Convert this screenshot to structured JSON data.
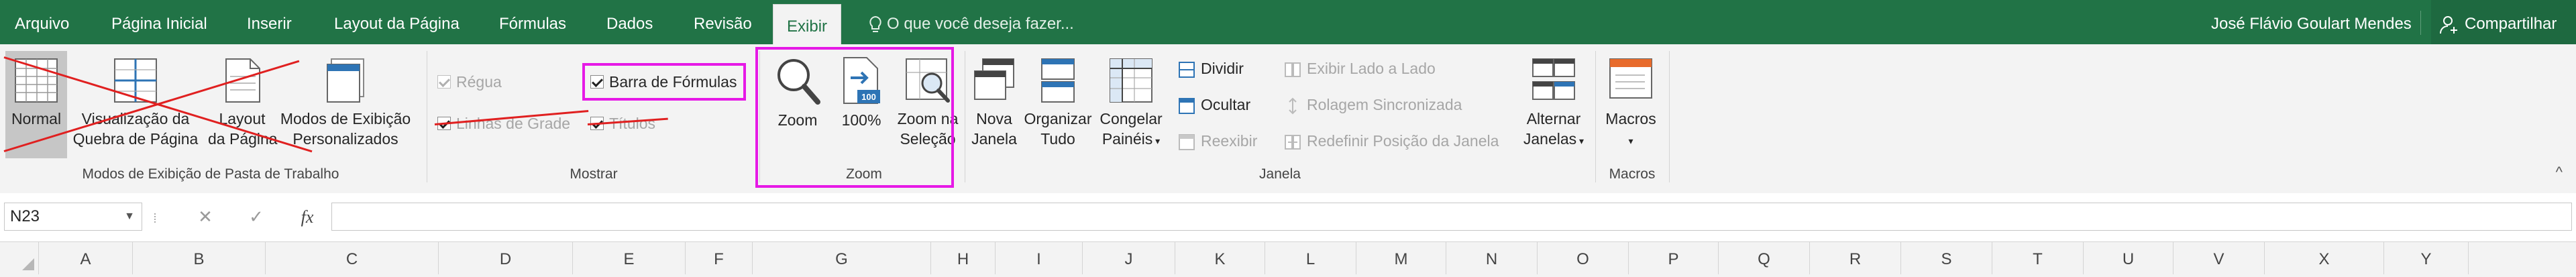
{
  "tabs": [
    {
      "label": "Arquivo"
    },
    {
      "label": "Página Inicial"
    },
    {
      "label": "Inserir"
    },
    {
      "label": "Layout da Página"
    },
    {
      "label": "Fórmulas"
    },
    {
      "label": "Dados"
    },
    {
      "label": "Revisão"
    },
    {
      "label": "Exibir",
      "active": true
    }
  ],
  "tell_me": "O que você deseja fazer...",
  "user_name": "José Flávio Goulart Mendes",
  "share_label": "Compartilhar",
  "ribbon": {
    "workbook_views": {
      "group_label": "Modos de Exibição de Pasta de Trabalho",
      "normal": "Normal",
      "page_break": [
        "Visualização da",
        "Quebra de Página"
      ],
      "page_layout": [
        "Layout",
        "da Página"
      ],
      "custom_views": [
        "Modos de Exibição",
        "Personalizados"
      ]
    },
    "show": {
      "group_label": "Mostrar",
      "ruler": "Régua",
      "ruler_checked": true,
      "gridlines": "Linhas de Grade",
      "gridlines_checked": true,
      "formula_bar": "Barra de Fórmulas",
      "formula_bar_checked": true,
      "headings": "Títulos",
      "headings_checked": true
    },
    "zoom": {
      "group_label": "Zoom",
      "zoom": "Zoom",
      "hundred": "100%",
      "hundred_icon_text": "100",
      "zoom_to_selection": [
        "Zoom na",
        "Seleção"
      ]
    },
    "window": {
      "group_label": "Janela",
      "new_window": [
        "Nova",
        "Janela"
      ],
      "arrange_all": [
        "Organizar",
        "Tudo"
      ],
      "freeze_panes": [
        "Congelar",
        "Painéis"
      ],
      "split": "Dividir",
      "hide": "Ocultar",
      "unhide": "Reexibir",
      "view_side_by_side": "Exibir Lado a Lado",
      "sync_scrolling": "Rolagem Sincronizada",
      "reset_window_position": "Redefinir Posição da Janela",
      "switch_windows": [
        "Alternar",
        "Janelas"
      ]
    },
    "macros": {
      "group_label": "Macros",
      "macros": "Macros"
    }
  },
  "formula_bar": {
    "name_box": "N23",
    "cancel_symbol": "✕",
    "enter_symbol": "✓",
    "fx_symbol": "fx",
    "formula": ""
  },
  "columns": [
    "A",
    "B",
    "C",
    "D",
    "E",
    "F",
    "G",
    "H",
    "I",
    "J",
    "K",
    "L",
    "M",
    "N",
    "O",
    "P",
    "Q",
    "R",
    "S",
    "T",
    "U",
    "V",
    "X",
    "Y"
  ],
  "colors": {
    "brand": "#217346",
    "highlight": "#e619e6",
    "strike": "#e02020"
  }
}
